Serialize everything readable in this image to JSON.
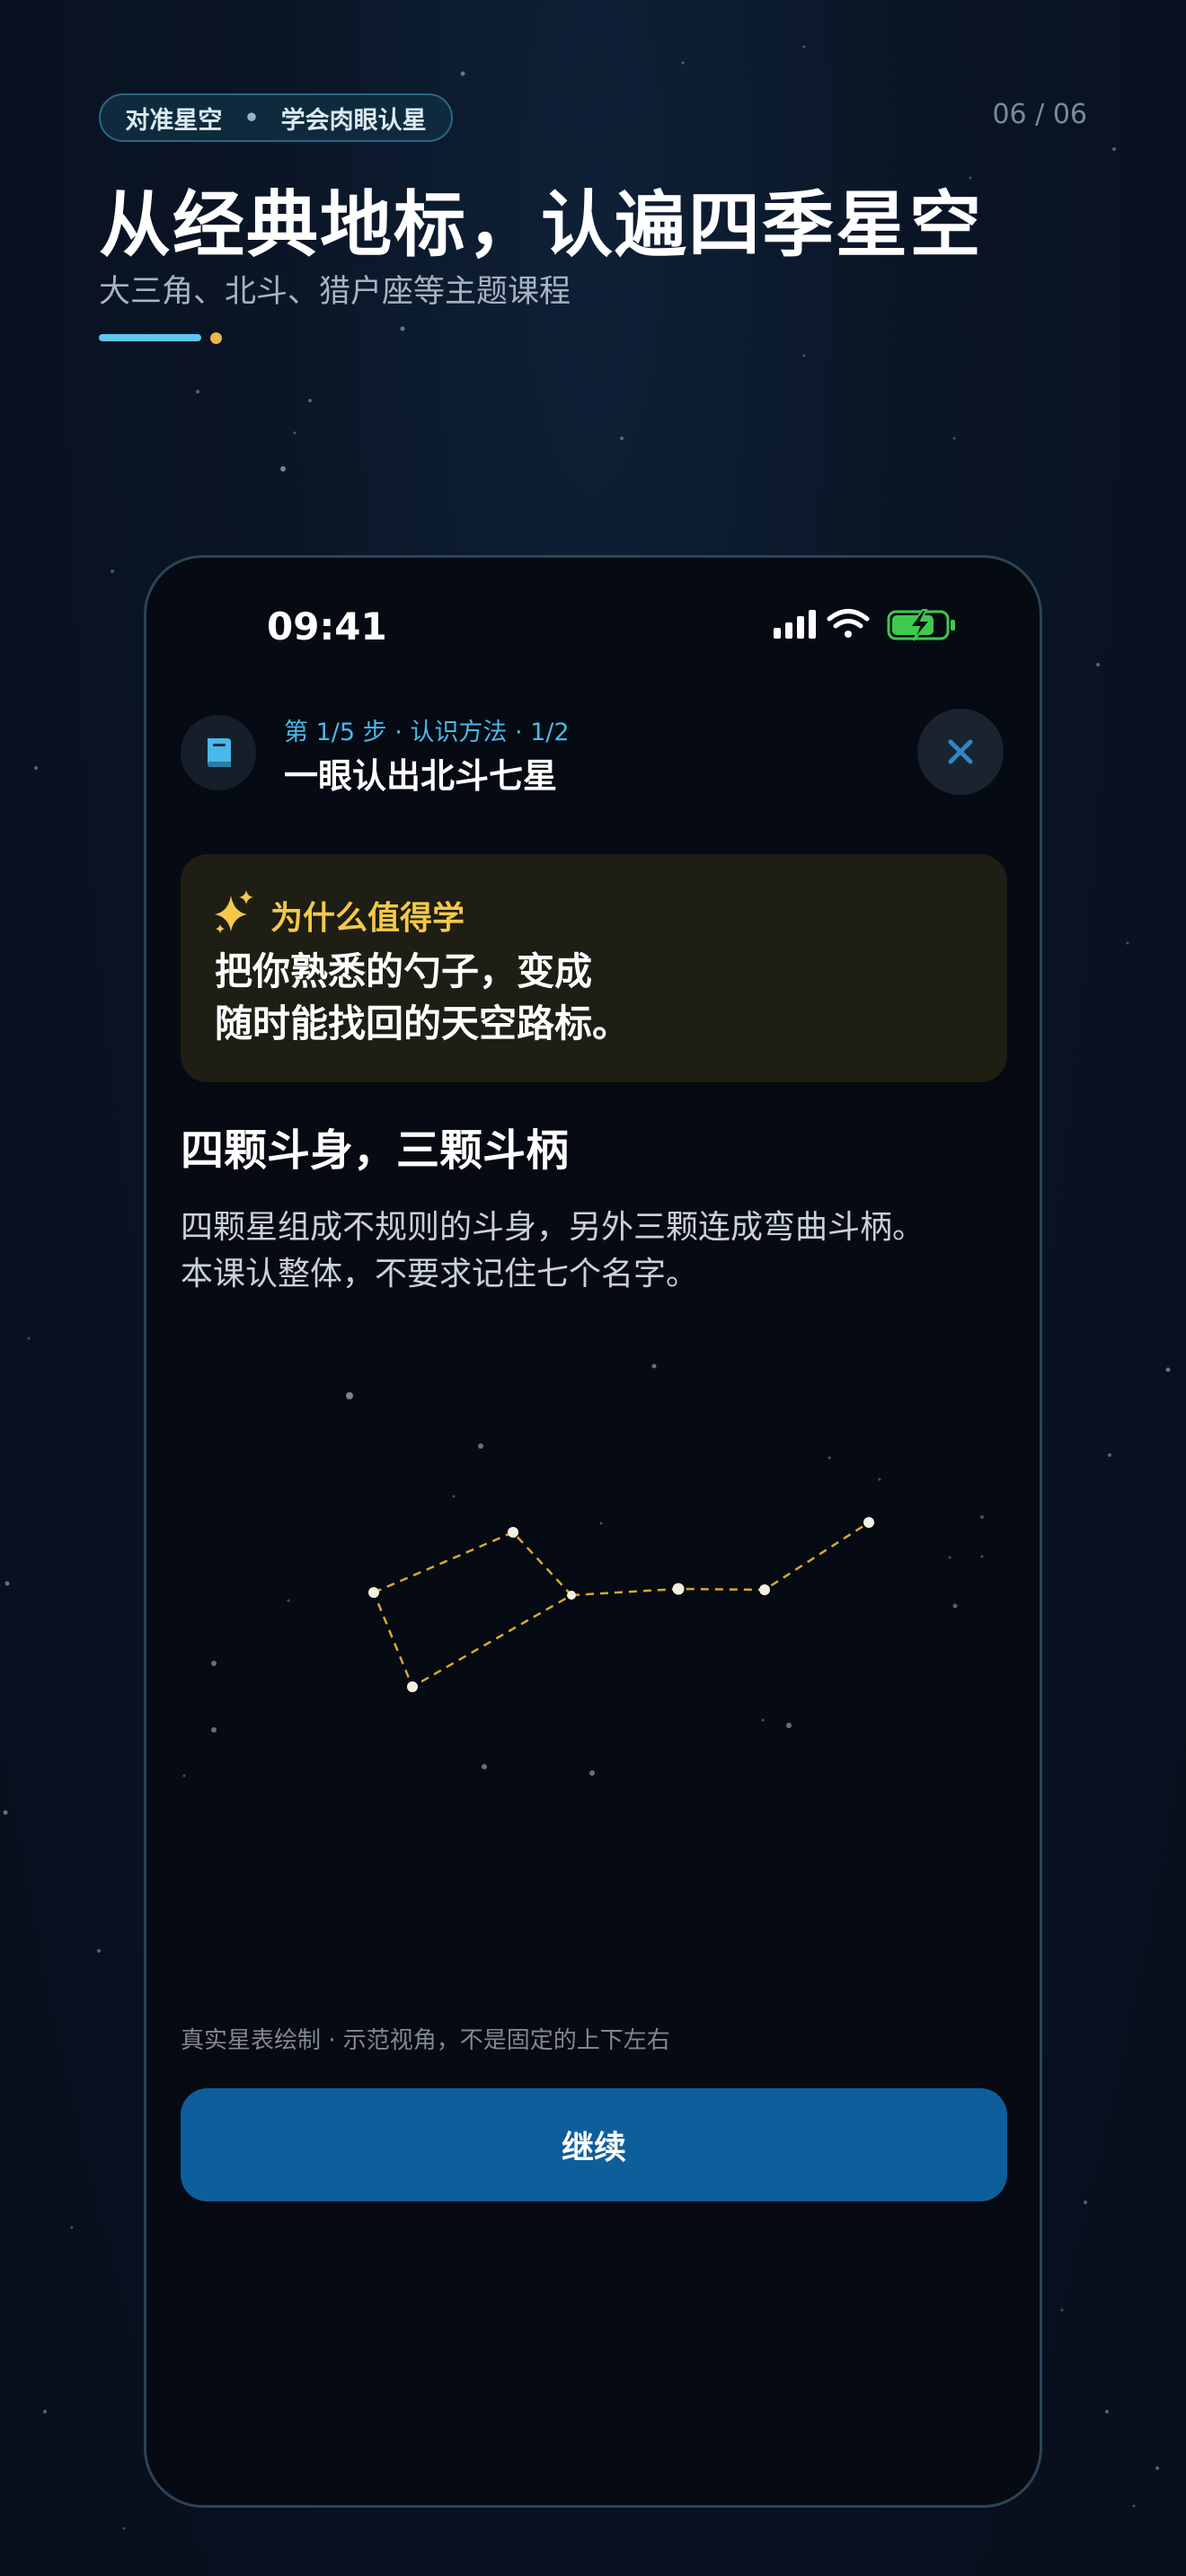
{
  "header": {
    "tag_left": "对准星空",
    "tag_sep": "•",
    "tag_right": "学会肉眼认星",
    "counter": "06 / 06",
    "headline": "从经典地标，认遍四季星空",
    "subhead": "大三角、北斗、猎户座等主题课程",
    "progress_accent": "#5cc8ef"
  },
  "status_bar": {
    "time": "09:41",
    "icons": [
      "signal-icon",
      "wifi-icon",
      "battery-charging-icon"
    ],
    "battery_color": "#3ec94f"
  },
  "lesson": {
    "step_line": "第 1/5 步 · 认识方法 · 1/2",
    "title": "一眼认出北斗七星",
    "book_icon": "book-icon",
    "close_icon": "close-icon"
  },
  "why_card": {
    "title": "为什么值得学",
    "icon": "sparkle-icon",
    "body_line1": "把你熟悉的勺子，变成",
    "body_line2": "随时能找回的天空路标。",
    "accent": "#f4c94a"
  },
  "section": {
    "title": "四颗斗身，三颗斗柄",
    "desc_line1": "四颗星组成不规则的斗身，另外三颗连成弯曲斗柄。",
    "desc_line2": "本课认整体，不要求记住七个名字。"
  },
  "sky_chart": {
    "constellation": "北斗七星",
    "line_color": "#d9a92e"
  },
  "caption": "真实星表绘制 · 示范视角，不是固定的上下左右",
  "primary_button": "继续",
  "colors": {
    "background": "#0a1526",
    "button": "#0e5e9c",
    "step_blue": "#4ab8e8"
  }
}
